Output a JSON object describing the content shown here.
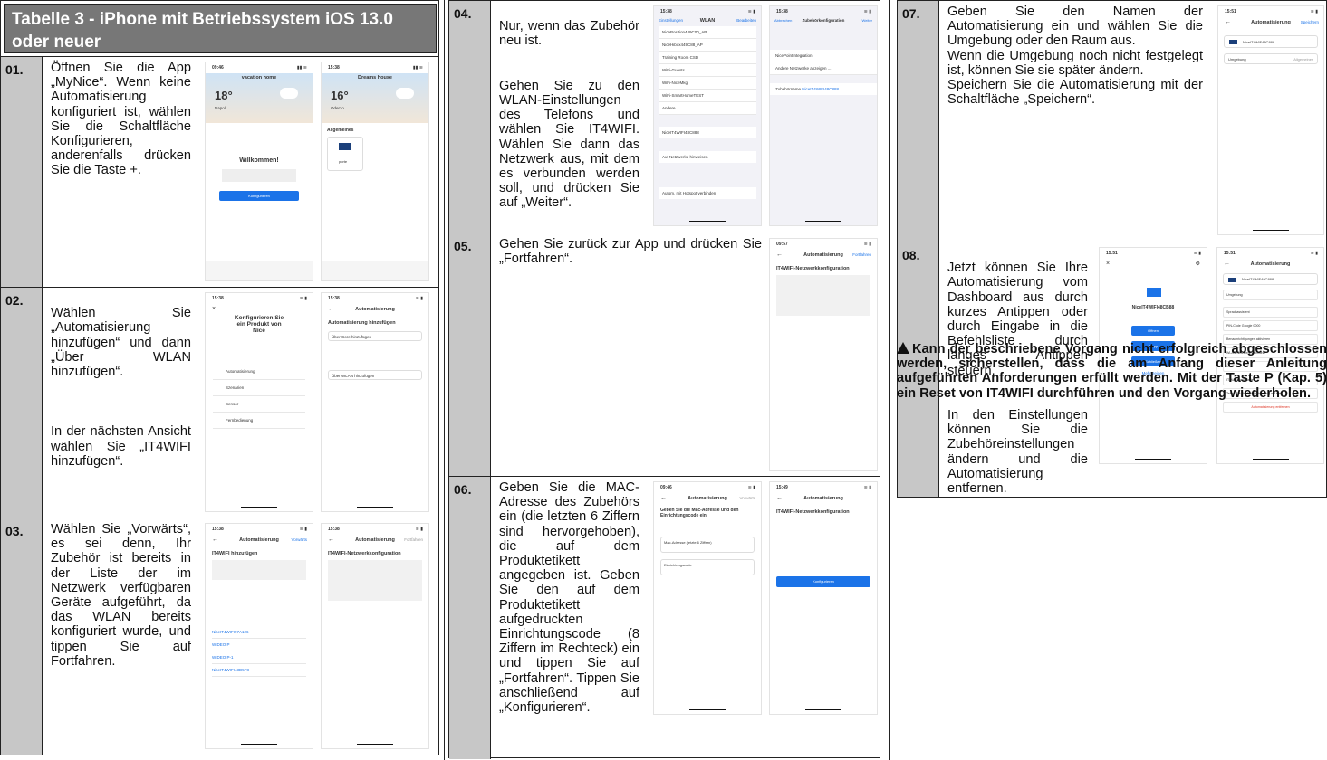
{
  "table_title": "Tabelle 3 - iPhone mit Betriebssystem iOS 13.0 oder neuer",
  "steps": {
    "s01": {
      "num": "01.",
      "text": "Öffnen Sie die App „MyNice“. Wenn keine Automatisierung konfiguriert ist, wählen Sie die Schaltfläche Konfigurieren, anderenfalls drücken Sie die Taste +."
    },
    "s02": {
      "num": "02.",
      "text": "Wählen Sie „Automatisierung hinzufügen“ und dann „Über WLAN hinzufügen“.",
      "text2": "In der nächsten Ansicht wählen Sie „IT4WIFI hinzufügen“."
    },
    "s03": {
      "num": "03.",
      "text": "Wählen Sie „Vorwärts“, es sei denn, Ihr Zubehör ist bereits in der Liste der im Netzwerk verfügbaren Geräte aufgeführt, da das WLAN bereits konfiguriert wurde, und tippen Sie auf Fortfahren."
    },
    "s04": {
      "num": "04.",
      "text": "Nur, wenn das Zubehör neu ist.",
      "text2": "Gehen Sie zu den WLAN-Einstellungen des Telefons und wählen Sie IT4WIFI. Wählen Sie dann das Netzwerk aus, mit dem es verbunden werden soll, und drücken Sie auf „Weiter“."
    },
    "s05": {
      "num": "05.",
      "text": "Gehen Sie zurück zur App und drücken Sie „Fortfahren“."
    },
    "s06": {
      "num": "06.",
      "text": "Geben Sie die MAC-Adresse des Zubehörs ein (die letzten 6 Ziffern sind hervorgehoben), die auf dem Produktetikett angegeben ist. Geben Sie den auf dem Produktetikett aufgedruckten Einrichtungscode (8 Ziffern im Rechteck) ein und tippen Sie auf „Fortfahren“. Tippen Sie anschließend auf „Konfigurieren“."
    },
    "s07": {
      "num": "07.",
      "text": "Geben Sie den Namen der Automatisierung ein und wählen Sie die Umgebung oder den Raum aus.\nWenn die Umgebung noch nicht festgelegt ist, können Sie sie später ändern.\nSpeichern Sie die Automatisierung mit der Schaltfläche „Speichern“."
    },
    "s08": {
      "num": "08.",
      "text": "Jetzt können Sie Ihre Automatisierung vom Dashboard aus durch kurzes Antippen oder durch Eingabe in die Befehlsliste durch langes Antippen steuern.",
      "text2": "In den Einstellungen können Sie die Zubehöreinstellungen ändern und die Automatisierung entfernen."
    }
  },
  "warning": "Kann der beschriebene Vorgang nicht erfolgreich abgeschlossen werden, sicherstellen, dass die am Anfang dieser Anleitung aufgeführten Anforderungen erfüllt werden. Mit der Taste P (Kap. 5) ein Reset von IT4WIFI durchführen und den Vorgang wiederholen.",
  "screens": {
    "p1a": {
      "time": "09:46",
      "title": "vacation home",
      "temp": "18°",
      "city": "Napoli",
      "welcome": "Willkommen!",
      "button": "Konfigurieren"
    },
    "p1b": {
      "time": "15:38",
      "title": "Dreams house",
      "temp": "16°",
      "city": "Oderzo",
      "section": "Allgemeines",
      "device": "porte"
    },
    "p2a": {
      "time": "15:38",
      "title": "Konfigurieren Sie ein Produkt von Nice",
      "items": [
        "Automatisierung",
        "Szenarien",
        "Sensor",
        "Fernbedienung"
      ]
    },
    "p2b": {
      "time": "15:38",
      "header": "Automatisierung",
      "title": "Automatisierung hinzufügen",
      "opt1": "Über Core hinzufügen",
      "opt2": "Über WLAN hinzufügen"
    },
    "p3a": {
      "time": "15:38",
      "header": "Automatisierung",
      "action": "Vorwärts",
      "title": "IT4WIFI hinzufügen",
      "list": [
        "NiceIT4WIFI97A126",
        "WIDEO P",
        "WIDEO P-1",
        "NiceIT4WIFI43D5F8"
      ]
    },
    "p3b": {
      "time": "15:38",
      "header": "Automatisierung",
      "action": "Fortfahren",
      "title": "IT4WIFI-Netzwerkkonfiguration"
    },
    "p4a": {
      "time": "15:38",
      "back": "Einstellungen",
      "header": "WLAN",
      "action": "Bearbeiten",
      "list": [
        "NicePosition449C00_AP",
        "NiceHibox449C88_AP",
        "Training Room CSD",
        "WiFi-Guests",
        "WiFi-NiceMkg",
        "WiFi-SmartHomeTEST",
        "Andere ...",
        "NiceIT4WIFI48C888",
        "Auf Netzwerke hinweisen",
        "Autom. mit Hotspot verbinden"
      ]
    },
    "p4b": {
      "time": "15:38",
      "cancel": "Abbrechen",
      "header": "Zubehörkonfiguration",
      "action": "Weiter",
      "net": "NicePointIntegration",
      "other": "Andere Netzwerke anzeigen ...",
      "name_label": "Zubehörname",
      "name": "NiceIT4WIFI48C888"
    },
    "p5a": {
      "time": "09:57",
      "header": "Automatisierung",
      "action": "Fortfahren",
      "title": "IT4WIFI-Netzwerkkonfiguration"
    },
    "p6a": {
      "time": "09:46",
      "header": "Automatisierung",
      "action": "Vorwärts",
      "title": "Geben Sie die Mac-Adresse und den Einrichtungscode ein.",
      "f1": "Mac-Adresse (letzte 6 Ziffern)",
      "f2": "Einrichtungscode"
    },
    "p6b": {
      "time": "15:49",
      "header": "Automatisierung",
      "title": "IT4WIFI-Netzwerkkonfiguration",
      "button": "Konfigurieren"
    },
    "p7a": {
      "time": "15:51",
      "header": "Automatisierung",
      "action": "Speichern",
      "name": "NiceIT4WIF48C888",
      "env": "Umgebung",
      "env_val": "Allgemeines"
    },
    "p8a": {
      "time": "15:51",
      "name": "NiceIT4WIFI48CB88",
      "b1": "Öffnen",
      "b2": "Stopp",
      "b3": "Schließen",
      "more": "Mehr zeigen"
    },
    "p8b": {
      "time": "15:51",
      "header": "Automatisierung",
      "name": "NiceIT4WIF48C888",
      "rows": [
        "Umgebung",
        "Sprachassistent",
        "PIN-Code Google",
        "Benachrichtigungen aktivieren",
        "WLAN-Netzwerk wechseln",
        "Info",
        "IT4WIFI neu starten",
        "Teilen Sie die Automatisierung mit eine..."
      ],
      "pin": "0000",
      "remove": "Automatisierung entfernen"
    }
  }
}
